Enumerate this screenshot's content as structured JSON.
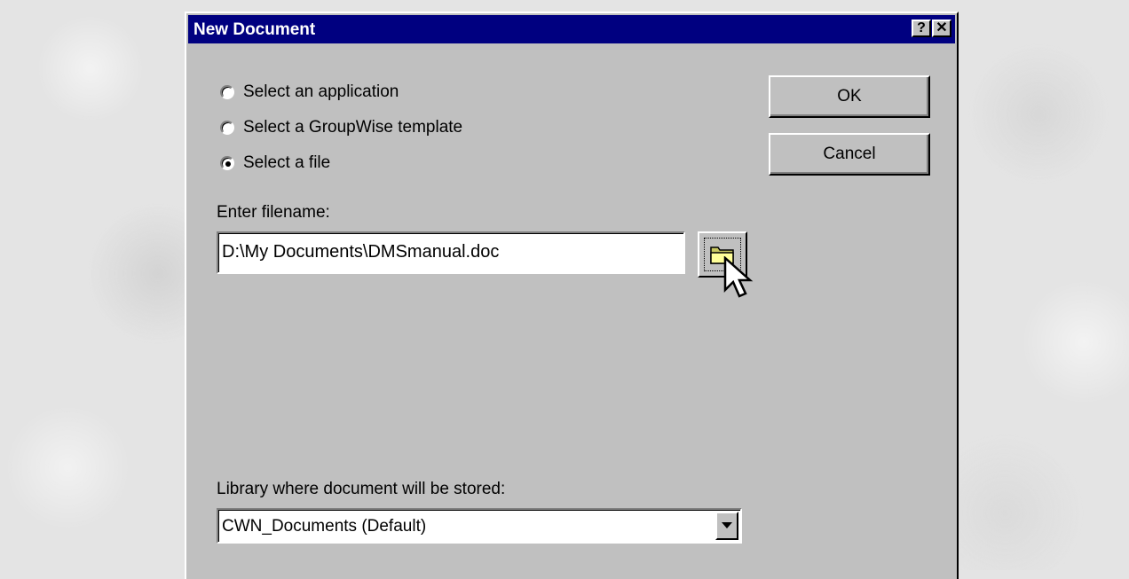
{
  "dialog": {
    "title": "New Document",
    "help_button": "?",
    "close_button": "✕"
  },
  "options": [
    {
      "label": "Select an application",
      "selected": false
    },
    {
      "label": "Select a GroupWise template",
      "selected": false
    },
    {
      "label": "Select a file",
      "selected": true
    }
  ],
  "buttons": {
    "ok": "OK",
    "cancel": "Cancel"
  },
  "filename": {
    "label": "Enter filename:",
    "value": "D:\\My Documents\\DMSmanual.doc",
    "browse_icon": "folder-icon"
  },
  "library": {
    "label": "Library where document will be stored:",
    "value": "CWN_Documents  (Default)"
  },
  "colors": {
    "titlebar": "#000080",
    "dialog_bg": "#c0c0c0",
    "folder": "#ffff99"
  }
}
